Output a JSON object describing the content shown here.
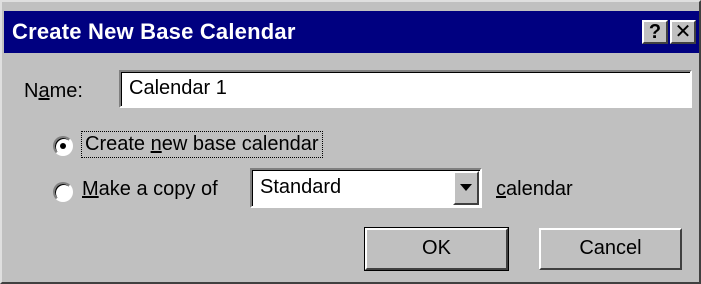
{
  "window": {
    "title": "Create New Base Calendar",
    "help_glyph": "?",
    "close_glyph": "✕"
  },
  "name_field": {
    "label_pre": "N",
    "label_access": "a",
    "label_post": "me:",
    "value": "Calendar 1"
  },
  "options": {
    "create_new": {
      "pre": "Create ",
      "access": "n",
      "post": "ew base calendar",
      "selected": true
    },
    "make_copy": {
      "pre": "",
      "access": "M",
      "post": "ake a copy of",
      "selected": false
    }
  },
  "copy_source": {
    "selected_value": "Standard"
  },
  "calendar_suffix": {
    "access": "c",
    "post": "alendar"
  },
  "buttons": {
    "ok": "OK",
    "cancel": "Cancel"
  },
  "colors": {
    "titlebar": "#000080",
    "face": "#c0c0c0"
  }
}
